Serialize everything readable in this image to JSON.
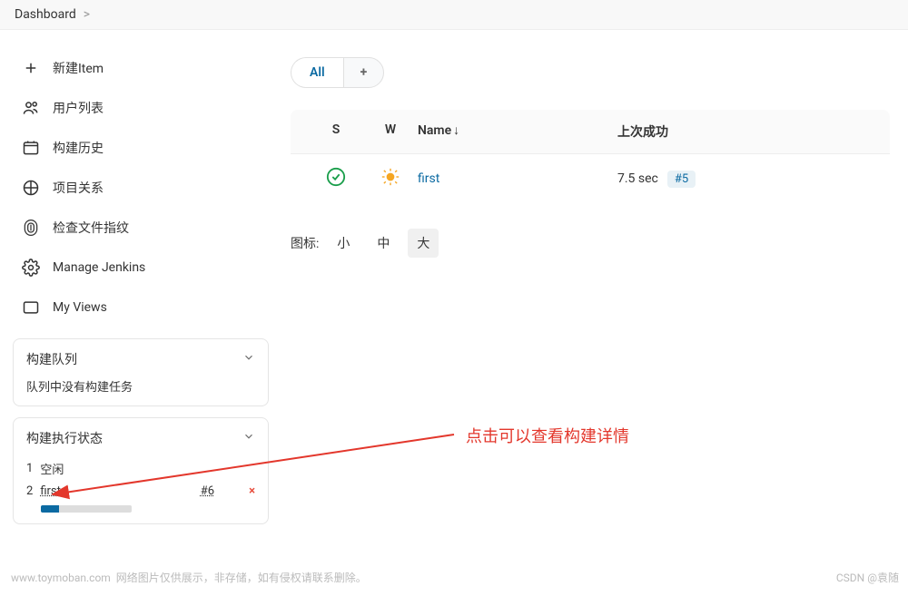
{
  "breadcrumb": {
    "item": "Dashboard",
    "sep": ">"
  },
  "sidebar": {
    "items": [
      {
        "label": "新建Item"
      },
      {
        "label": "用户列表"
      },
      {
        "label": "构建历史"
      },
      {
        "label": "项目关系"
      },
      {
        "label": "检查文件指纹"
      },
      {
        "label": "Manage Jenkins"
      },
      {
        "label": "My Views"
      }
    ],
    "queue": {
      "title": "构建队列",
      "empty": "队列中没有构建任务"
    },
    "executors": {
      "title": "构建执行状态",
      "rows": [
        {
          "num": "1",
          "label": "空闲"
        },
        {
          "num": "2",
          "label": "first",
          "build": "#6",
          "cancel": "×"
        }
      ]
    }
  },
  "tabs": {
    "active": "All",
    "add": "+"
  },
  "table": {
    "headers": {
      "s": "S",
      "w": "W",
      "name": "Name",
      "sort": "↓",
      "last_success": "上次成功"
    },
    "rows": [
      {
        "name": "first",
        "last_success_text": "7.5 sec",
        "build": "#5"
      }
    ]
  },
  "icon_size": {
    "label": "图标:",
    "small": "小",
    "medium": "中",
    "large": "大"
  },
  "annotation": "点击可以查看构建详情",
  "footer": {
    "left_url": "www.toymoban.com",
    "left_text": "网络图片仅供展示，非存储，如有侵权请联系删除。",
    "right": "CSDN @袁随"
  }
}
